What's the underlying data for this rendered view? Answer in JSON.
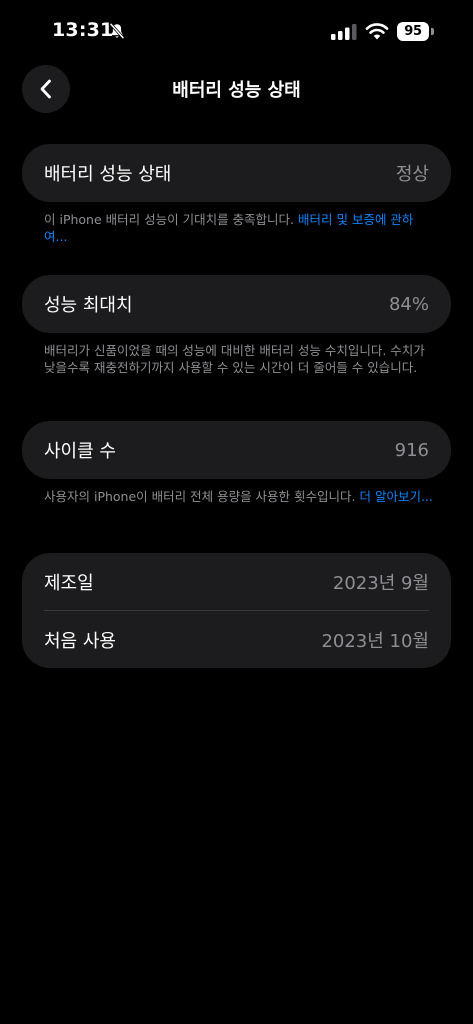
{
  "status_bar": {
    "time": "13:31",
    "battery_level": "95"
  },
  "nav": {
    "title": "배터리 성능 상태"
  },
  "health": {
    "label": "배터리 성능 상태",
    "value": "정상",
    "footnote": "이 iPhone 배터리 성능이 기대치를 충족합니다. ",
    "link": "배터리 및 보증에 관하여..."
  },
  "max_capacity": {
    "label": "성능 최대치",
    "value": "84%",
    "footnote": "배터리가 신품이었을 때의 성능에 대비한 배터리 성능 수치입니다. 수치가 낮을수록 재충전하기까지 사용할 수 있는 시간이 더 줄어들 수 있습니다."
  },
  "cycle_count": {
    "label": "사이클 수",
    "value": "916",
    "footnote": "사용자의 iPhone이 배터리 전체 용량을 사용한 횟수입니다. ",
    "link": "더 알아보기..."
  },
  "dates": {
    "manufacture_label": "제조일",
    "manufacture_value": "2023년 9월",
    "first_use_label": "처음 사용",
    "first_use_value": "2023년 10월"
  },
  "icons": {
    "back": "chevron-left-icon",
    "silent": "bell-off-icon",
    "signal": "cellular-signal-icon",
    "wifi": "wifi-icon",
    "battery": "battery-icon"
  },
  "colors": {
    "background": "#000000",
    "card": "#1c1c1e",
    "secondary_text": "#8e8e93",
    "link": "#0a84ff"
  }
}
